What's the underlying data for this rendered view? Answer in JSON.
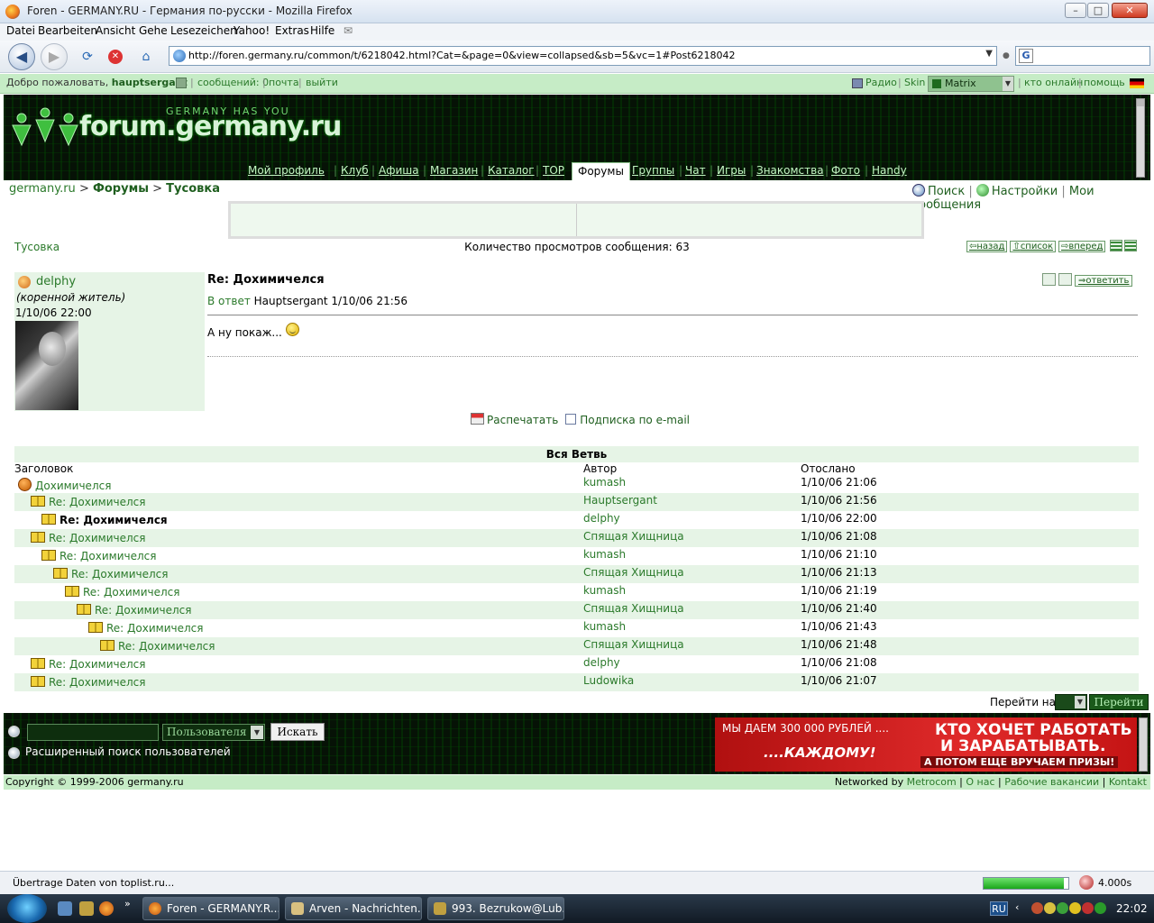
{
  "browser": {
    "window_title": "Foren - GERMANY.RU - Германия по-русски - Mozilla Firefox",
    "menu": [
      "Datei",
      "Bearbeiten",
      "Ansicht",
      "Gehe",
      "Lesezeichen",
      "Yahoo!",
      "Extras",
      "Hilfe"
    ],
    "url": "http://foren.germany.ru/common/t/6218042.html?Cat=&page=0&view=collapsed&sb=5&vc=1#Post6218042",
    "status_text": "Übertrage Daten von toplist.ru...",
    "load_progress": 0.95,
    "load_time": "4.000s"
  },
  "userbar": {
    "welcome": "Добро пожаловать,",
    "username": "hauptsergant",
    "messages": "сообщений: 0",
    "mail": "почта",
    "logout": "выйти",
    "radio": "Радио",
    "skin_label": "Skin",
    "skin_value": "Matrix",
    "online": "кто онлайн",
    "help": "помощь"
  },
  "header": {
    "logo_text": "forum.germany.ru",
    "logo_tagline": "GERMANY HAS YOU",
    "tabs": [
      "Мой профиль",
      "Клуб",
      "Афиша",
      "Магазин",
      "Каталог",
      "TOP",
      "Форумы",
      "Группы",
      "Чат",
      "Игры",
      "Знакомства",
      "Фото",
      "Handy"
    ],
    "active_tab": "Форумы"
  },
  "breadcrumb": {
    "home": "germany.ru",
    "sep": ">",
    "forums": "Форумы",
    "current": "Тусовка"
  },
  "toplinks": {
    "search": "Поиск",
    "settings": "Настройки",
    "my_messages": "Мои сообщения"
  },
  "forum": {
    "name": "Тусовка",
    "views_label": "Количество просмотров сообщения:",
    "views_count": "63",
    "back": "назад",
    "list": "список",
    "forward": "вперед"
  },
  "post": {
    "author": "delphy",
    "author_status": "(коренной житель)",
    "date": "1/10/06 22:00",
    "title": "Re: Дохимичелся",
    "reply_label": "В ответ",
    "reply_to": "Hauptsergant 1/10/06 21:56",
    "body": "А ну покаж...",
    "answer_btn": "ответить",
    "print": "Распечатать",
    "subscribe": "Подписка по e-mail"
  },
  "thread": {
    "caption": "Вся Ветвь",
    "col_title": "Заголовок",
    "col_author": "Автор",
    "col_date": "Отослано",
    "rows": [
      {
        "title": "Дохимичелся",
        "author": "kumash",
        "date": "1/10/06 21:06"
      },
      {
        "title": "Re: Дохимичелся",
        "author": "Hauptsergant",
        "date": "1/10/06 21:56"
      },
      {
        "title": "Re: Дохимичелся",
        "author": "delphy",
        "date": "1/10/06 22:00"
      },
      {
        "title": "Re: Дохимичелся",
        "author": "Спящая Хищница",
        "date": "1/10/06 21:08"
      },
      {
        "title": "Re: Дохимичелся",
        "author": "kumash",
        "date": "1/10/06 21:10"
      },
      {
        "title": "Re: Дохимичелся",
        "author": "Спящая Хищница",
        "date": "1/10/06 21:13"
      },
      {
        "title": "Re: Дохимичелся",
        "author": "kumash",
        "date": "1/10/06 21:19"
      },
      {
        "title": "Re: Дохимичелся",
        "author": "Спящая Хищница",
        "date": "1/10/06 21:40"
      },
      {
        "title": "Re: Дохимичелся",
        "author": "kumash",
        "date": "1/10/06 21:43"
      },
      {
        "title": "Re: Дохимичелся",
        "author": "Спящая Хищница",
        "date": "1/10/06 21:48"
      },
      {
        "title": "Re: Дохимичелся",
        "author": "delphy",
        "date": "1/10/06 21:08"
      },
      {
        "title": "Re: Дохимичелся",
        "author": "Ludowika",
        "date": "1/10/06 21:07"
      }
    ]
  },
  "goto": {
    "label": "Перейти на",
    "button": "Перейти"
  },
  "footer_search": {
    "select_value": "Пользователя",
    "button": "Искать",
    "advanced": "Расширенный поиск пользователей"
  },
  "promo": {
    "line1": "МЫ ДАЕМ 300 000 РУБЛЕЙ ....",
    "line2": "....КАЖДОМУ!",
    "right1": "КТО ХОЧЕТ РАБОТАТЬ",
    "right2": "И ЗАРАБАТЫВАТЬ.",
    "right3": "А ПОТОМ ЕЩЕ ВРУЧАЕМ ПРИЗЫ!"
  },
  "copyright": {
    "text": "Copyright © 1999-2006 germany.ru",
    "networked_by": "Networked by",
    "metrocom": "Metrocom",
    "about": "О нас",
    "jobs": "Рабочие вакансии",
    "contact": "Kontakt"
  },
  "taskbar": {
    "tasks": [
      "Foren - GERMANY.R...",
      "Arven - Nachrichten...",
      "993. Bezrukow@Lub..."
    ],
    "lang": "RU",
    "clock": "22:02"
  }
}
